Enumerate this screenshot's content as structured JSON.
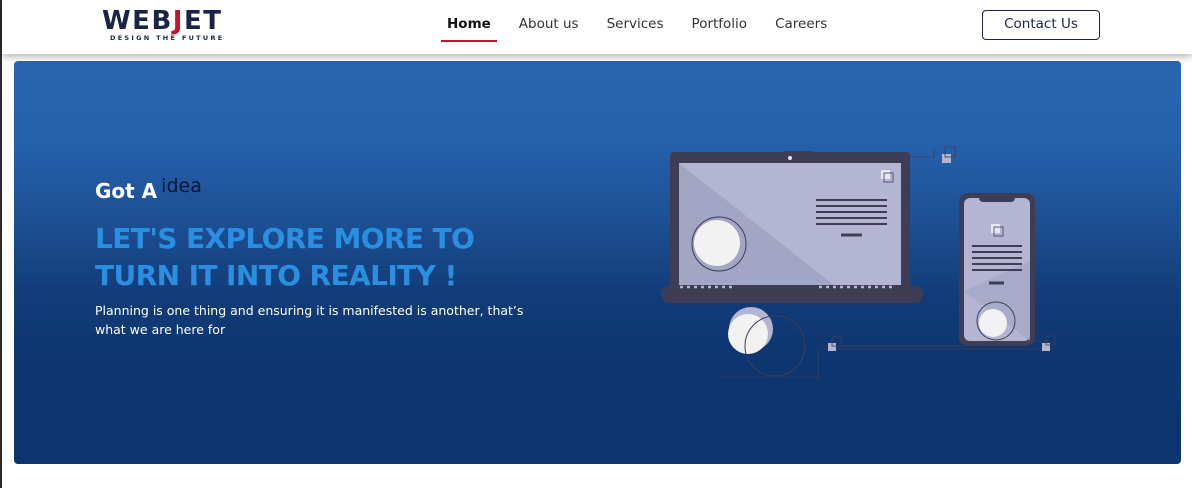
{
  "brand": {
    "name_part1": "WEB",
    "name_accent": "J",
    "name_part2": "ET",
    "tagline": "DESIGN THE FUTURE"
  },
  "nav": {
    "items": [
      {
        "label": "Home",
        "active": true
      },
      {
        "label": "About us",
        "active": false
      },
      {
        "label": "Services",
        "active": false
      },
      {
        "label": "Portfolio",
        "active": false
      },
      {
        "label": "Careers",
        "active": false
      }
    ],
    "contact_label": "Contact Us"
  },
  "hero": {
    "got_a": "Got A",
    "idea": "idea",
    "headline_line1": "LET'S EXPLORE MORE TO",
    "headline_line2": "TURN IT INTO REALITY !",
    "description": "Planning is one thing and ensuring it is manifested is another, that’s what we are here for"
  },
  "colors": {
    "brand_navy": "#1c2445",
    "brand_red": "#c4122f",
    "hero_blue_top": "#2a65b0",
    "hero_blue_bottom": "#0c346d",
    "headline_blue": "#2a8fe0",
    "device_dark": "#3f3d56",
    "device_screen": "#b3b5d3"
  },
  "illustration": {
    "icon": "laptop-and-phone-icon"
  }
}
